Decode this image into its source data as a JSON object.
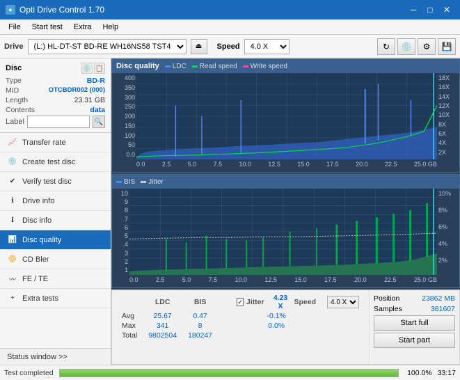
{
  "titlebar": {
    "title": "Opti Drive Control 1.70",
    "minimize": "─",
    "maximize": "□",
    "close": "✕"
  },
  "menubar": {
    "items": [
      "File",
      "Start test",
      "Extra",
      "Help"
    ]
  },
  "drivebar": {
    "label": "Drive",
    "drive_value": "(L:)  HL-DT-ST BD-RE  WH16NS58 TST4",
    "eject": "⏏",
    "speed_label": "Speed",
    "speed_value": "4.0 X",
    "icon1": "🔄",
    "icon2": "💾",
    "icon3": "📋",
    "icon4": "💾"
  },
  "disc": {
    "title": "Disc",
    "type_label": "Type",
    "type_value": "BD-R",
    "mid_label": "MID",
    "mid_value": "OTCBDR002 (000)",
    "length_label": "Length",
    "length_value": "23.31 GB",
    "contents_label": "Contents",
    "contents_value": "data",
    "label_label": "Label"
  },
  "nav": {
    "items": [
      {
        "label": "Transfer rate",
        "id": "transfer-rate"
      },
      {
        "label": "Create test disc",
        "id": "create-test-disc"
      },
      {
        "label": "Verify test disc",
        "id": "verify-test-disc"
      },
      {
        "label": "Drive info",
        "id": "drive-info"
      },
      {
        "label": "Disc info",
        "id": "disc-info"
      },
      {
        "label": "Disc quality",
        "id": "disc-quality",
        "active": true
      },
      {
        "label": "CD Bler",
        "id": "cd-bler"
      },
      {
        "label": "FE / TE",
        "id": "fe-te"
      },
      {
        "label": "Extra tests",
        "id": "extra-tests"
      }
    ],
    "status_window": "Status window >>"
  },
  "chart1": {
    "title": "Disc quality",
    "legend": [
      {
        "label": "LDC",
        "color": "#4488ff"
      },
      {
        "label": "Read speed",
        "color": "#00ff88"
      },
      {
        "label": "Write speed",
        "color": "#ff44aa"
      }
    ],
    "y_axis_left": [
      "400",
      "350",
      "300",
      "250",
      "200",
      "150",
      "100",
      "50",
      "0.0"
    ],
    "y_axis_right": [
      "18X",
      "16X",
      "14X",
      "12X",
      "10X",
      "8X",
      "6X",
      "4X",
      "2X"
    ],
    "x_axis": [
      "0.0",
      "2.5",
      "5.0",
      "7.5",
      "10.0",
      "12.5",
      "15.0",
      "17.5",
      "20.0",
      "22.5",
      "25.0 GB"
    ]
  },
  "chart2": {
    "legend": [
      {
        "label": "BIS",
        "color": "#4488ff"
      },
      {
        "label": "Jitter",
        "color": "#dddddd"
      }
    ],
    "y_axis_left": [
      "10",
      "9",
      "8",
      "7",
      "6",
      "5",
      "4",
      "3",
      "2",
      "1"
    ],
    "y_axis_right": [
      "10%",
      "8%",
      "6%",
      "4%",
      "2%"
    ],
    "x_axis": [
      "0.0",
      "2.5",
      "5.0",
      "7.5",
      "10.0",
      "12.5",
      "15.0",
      "17.5",
      "20.0",
      "22.5",
      "25.0 GB"
    ]
  },
  "stats": {
    "headers": [
      "LDC",
      "BIS",
      "",
      "Jitter",
      "Speed"
    ],
    "speed_display": "4.23 X",
    "speed_select": "4.0 X",
    "rows": [
      {
        "label": "Avg",
        "ldc": "25.67",
        "bis": "0.47",
        "jitter": "-0.1%"
      },
      {
        "label": "Max",
        "ldc": "341",
        "bis": "8",
        "jitter": "0.0%"
      },
      {
        "label": "Total",
        "ldc": "9802504",
        "bis": "180247",
        "jitter": ""
      }
    ],
    "position_label": "Position",
    "position_value": "23862 MB",
    "samples_label": "Samples",
    "samples_value": "381607",
    "start_full": "Start full",
    "start_part": "Start part"
  },
  "statusbar": {
    "text": "Test completed",
    "progress": 100,
    "progress_text": "100.0%",
    "time": "33:17"
  },
  "colors": {
    "accent": "#1a6bbc",
    "chart_bg": "#2a3f5a",
    "ldc_color": "#4488ff",
    "speed_color": "#00dd44",
    "bis_color": "#4488ff",
    "jitter_color": "#cccccc"
  }
}
